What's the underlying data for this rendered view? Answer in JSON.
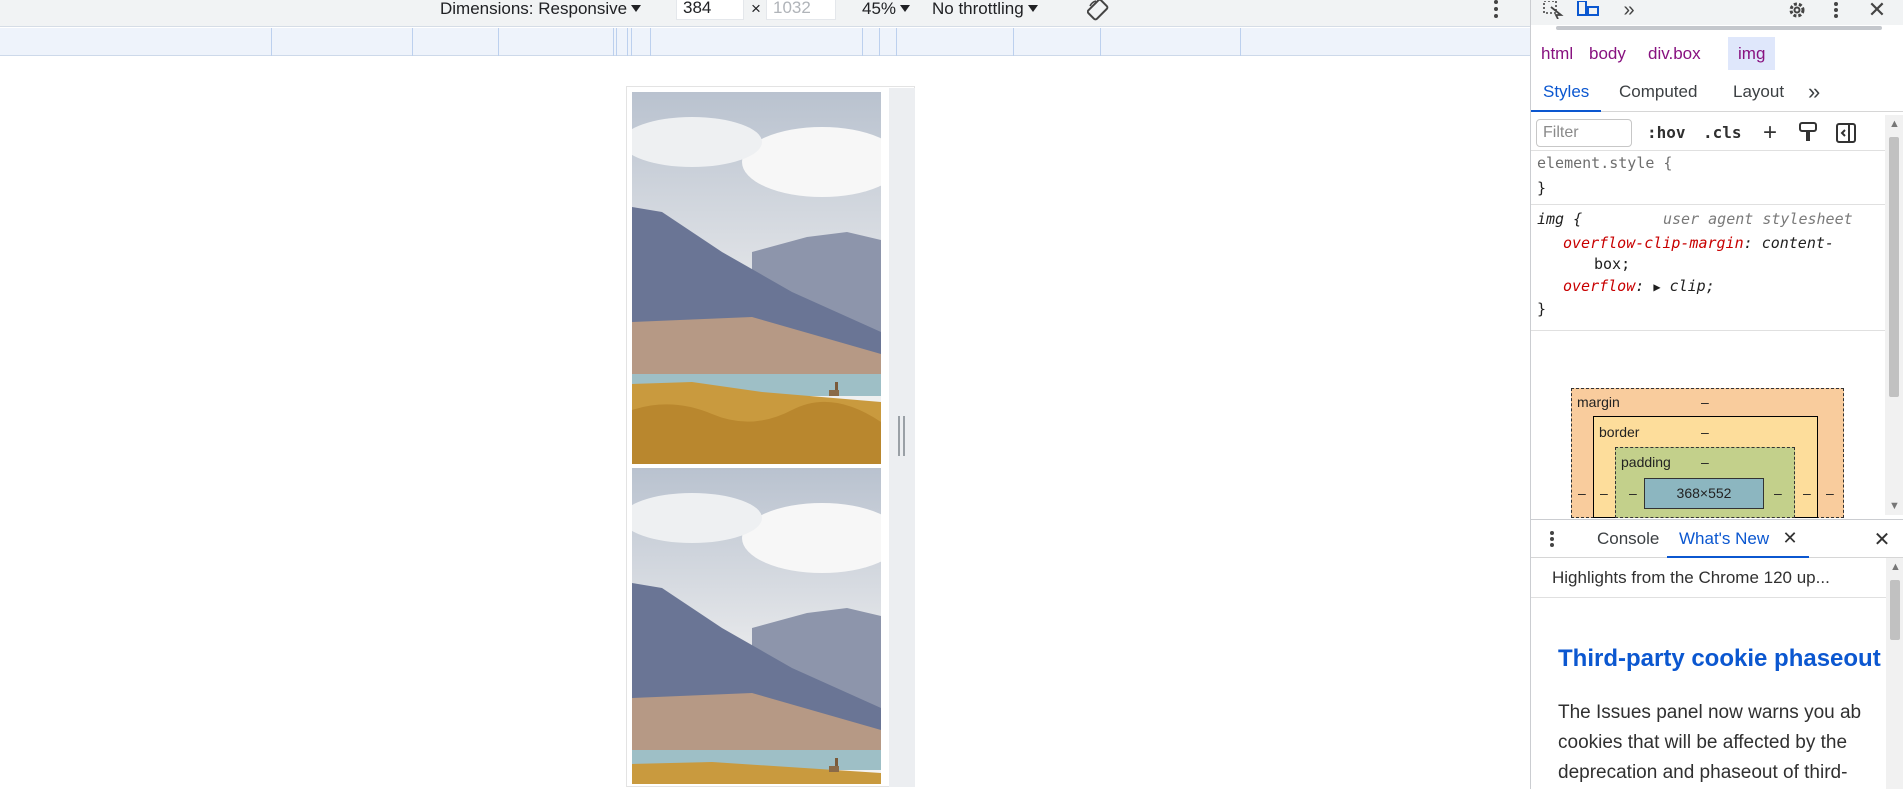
{
  "device_toolbar": {
    "dimensions_label": "Dimensions: Responsive",
    "width_value": "384",
    "times": "×",
    "height_placeholder": "1032",
    "zoom": "45%",
    "throttling": "No throttling"
  },
  "devtools": {
    "breadcrumbs": [
      "html",
      "body",
      "div.box",
      "img"
    ],
    "panel_tabs": [
      "Styles",
      "Computed",
      "Layout"
    ],
    "more_tabs": "»",
    "filter_placeholder": "Filter",
    "hov_label": ":hov",
    "cls_label": ".cls",
    "rules": {
      "element_style_selector": "element.style {",
      "close_brace": "}",
      "img_selector": "img {",
      "img_source": "user agent stylesheet",
      "prop1_name": "overflow-clip-margin",
      "prop1_value_a": "content-",
      "prop1_value_b": "box;",
      "prop2_name": "overflow",
      "prop2_value": "clip;"
    },
    "box_model": {
      "margin_label": "margin",
      "border_label": "border",
      "padding_label": "padding",
      "dash": "–",
      "content_size": "368×552"
    },
    "drawer": {
      "tabs": [
        "Console",
        "What's New"
      ],
      "header": "Highlights from the Chrome 120 up...",
      "article_title": "Third-party cookie phaseout",
      "article_lines": [
        "The Issues panel now warns you ab",
        "cookies that will be affected by the",
        "deprecation and phaseout of third-"
      ]
    }
  },
  "colors": {
    "accent": "#0b57d0",
    "tag": "#881280",
    "css_property": "#c80000"
  }
}
